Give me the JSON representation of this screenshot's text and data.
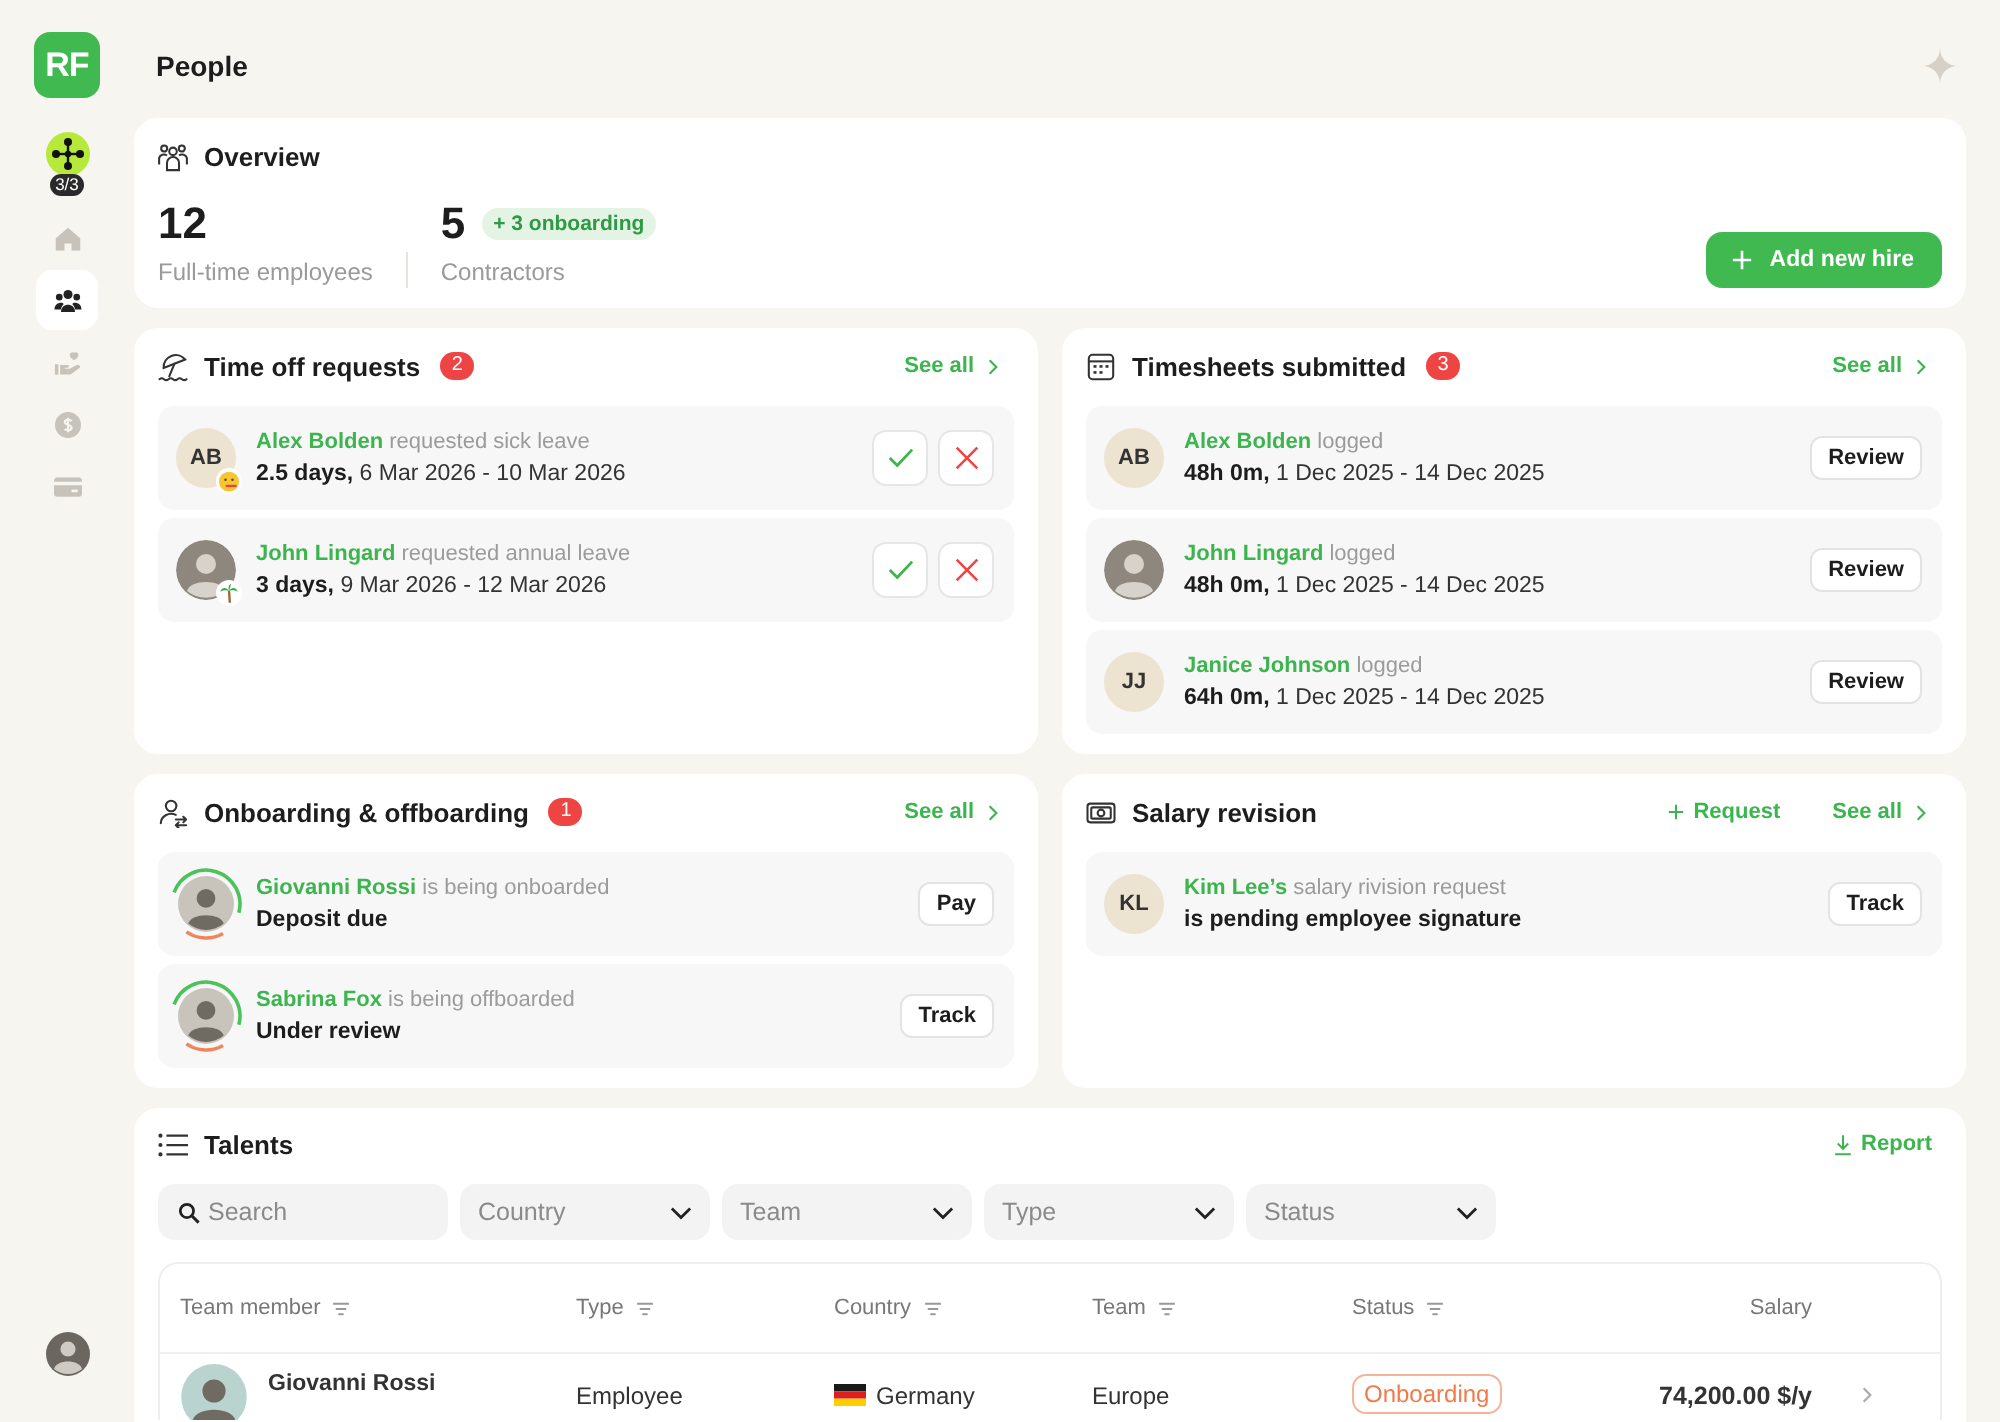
{
  "sidebar": {
    "logo": "RF",
    "progress_badge": "3/3",
    "items": [
      {
        "kind": "home",
        "selected": false
      },
      {
        "kind": "people",
        "selected": true
      },
      {
        "kind": "benefits",
        "selected": false
      },
      {
        "kind": "payments",
        "selected": false
      },
      {
        "kind": "cards",
        "selected": false
      }
    ]
  },
  "header": {
    "title": "People"
  },
  "overview": {
    "title": "Overview",
    "stats": [
      {
        "value": "12",
        "label": "Full-time employees"
      },
      {
        "value": "5",
        "badge": "+ 3 onboarding",
        "label": "Contractors"
      }
    ],
    "button": "Add new hire"
  },
  "time_off": {
    "title": "Time off requests",
    "count": "2",
    "link": "See all",
    "requests": [
      {
        "avatar": {
          "kind": "initials",
          "initials": "AB"
        },
        "leave_badge": {
          "kind": "sick"
        },
        "name": "Alex Bolden",
        "action": "requested sick leave",
        "details": "**2.5 days,** 6 Mar 2026 - 10 Mar 2026"
      },
      {
        "avatar": {
          "kind": "photo"
        },
        "leave_badge": {
          "kind": "vacation"
        },
        "name": "John Lingard",
        "action": "requested annual leave",
        "details": "**3 days,** 9 Mar 2026 - 12 Mar 2026"
      }
    ]
  },
  "timesheets": {
    "title": "Timesheets submitted",
    "count": "3",
    "link": "See all",
    "entries": [
      {
        "avatar": {
          "kind": "initials",
          "initials": "AB"
        },
        "name": "Alex Bolden",
        "action": "logged",
        "details": "**48h 0m,** 1 Dec 2025 - 14 Dec 2025",
        "button": "Review"
      },
      {
        "avatar": {
          "kind": "photo"
        },
        "name": "John Lingard",
        "action": "logged",
        "details": "**48h 0m,** 1 Dec 2025 - 14 Dec 2025",
        "button": "Review"
      },
      {
        "avatar": {
          "kind": "initials",
          "initials": "JJ"
        },
        "name": "Janice Johnson",
        "action": "logged",
        "details": "**64h 0m,** 1 Dec 2025 - 14 Dec 2025",
        "button": "Review"
      }
    ]
  },
  "onboarding": {
    "title": "Onboarding & offboarding",
    "count": "1",
    "link": "See all",
    "entries": [
      {
        "name": "Giovanni Rossi",
        "action": "is being onboarded",
        "status": "Deposit due",
        "button": "Pay"
      },
      {
        "name": "Sabrina Fox",
        "action": "is being offboarded",
        "status": "Under review",
        "button": "Track"
      }
    ]
  },
  "salary_revision": {
    "title": "Salary revision",
    "request_link": "Request",
    "link": "See all",
    "entries": [
      {
        "avatar": {
          "kind": "initials",
          "initials": "KL"
        },
        "name": "Kim Lee’s",
        "action": "salary rivision request",
        "status": "is pending employee signature",
        "button": "Track"
      }
    ]
  },
  "talents": {
    "title": "Talents",
    "report_link": "Report",
    "search": {
      "placeholder": "Search"
    },
    "filters": [
      "Country",
      "Team",
      "Type",
      "Status"
    ],
    "table": {
      "columns": [
        {
          "label": "Team member",
          "filterable": true
        },
        {
          "label": "Type",
          "filterable": true
        },
        {
          "label": "Country",
          "filterable": true
        },
        {
          "label": "Team",
          "filterable": true
        },
        {
          "label": "Status",
          "filterable": true
        },
        {
          "label": "Salary",
          "filterable": false
        }
      ],
      "rows": [
        {
          "name": "Giovanni Rossi",
          "type": "Employee",
          "country": "Germany",
          "team": "Europe",
          "status": "Onboarding",
          "salary": "74,200.00 $/y"
        }
      ]
    }
  }
}
